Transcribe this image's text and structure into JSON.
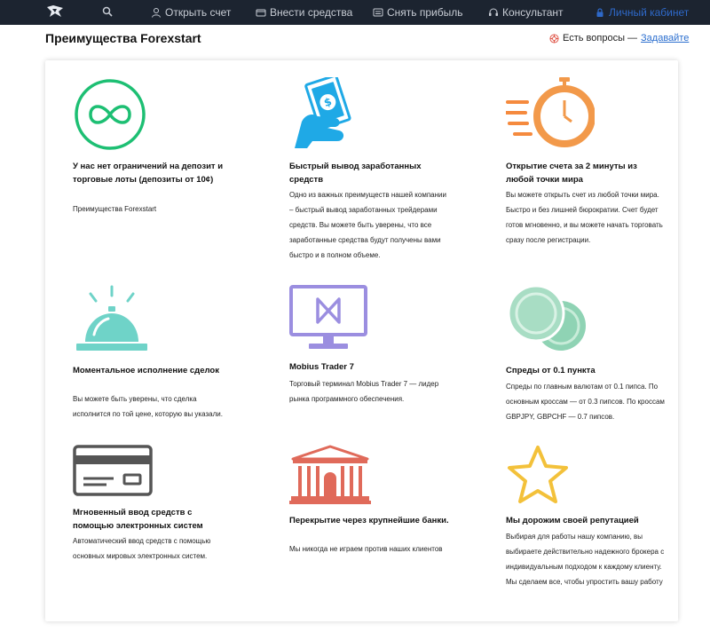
{
  "nav": {
    "items": [
      {
        "label": "Открыть счет",
        "icon": "user-icon"
      },
      {
        "label": "Внести средства",
        "icon": "wallet-icon"
      },
      {
        "label": "Снять прибыль",
        "icon": "cash-icon"
      },
      {
        "label": "Консультант",
        "icon": "headset-icon"
      },
      {
        "label": "Личный кабинет",
        "icon": "lock-icon"
      }
    ]
  },
  "header": {
    "title": "Преимущества Forexstart",
    "questions_text": "Есть вопросы —",
    "questions_link": "Задавайте"
  },
  "features": [
    {
      "title": "У нас нет ограничений на депозит и торговые лоты (депозиты от 10¢)",
      "desc": "Преимущества Forexstart",
      "icon": "infinity-icon",
      "color": "#1dbf73"
    },
    {
      "title": "Быстрый вывод заработанных средств",
      "desc": "Одно из важных преимуществ нашей компании – быстрый вывод заработанных трейдерами средств. Вы можете быть уверены, что все заработанные средства будут получены вами быстро и в полном объеме.",
      "icon": "hand-money-icon",
      "color": "#1fa9e6"
    },
    {
      "title": "Открытие счета за 2 минуты из любой точки мира",
      "desc": "Вы можете открыть счет из любой точки мира. Быстро и без лишней бюрократии. Счет будет готов мгновенно, и вы можете начать торговать сразу после регистрации.",
      "icon": "stopwatch-icon",
      "color": "#f2994a"
    },
    {
      "title": "Моментальное исполнение сделок",
      "desc": "Вы можете быть уверены, что сделка исполнится по той цене, которую вы указали.",
      "icon": "service-bell-icon",
      "color": "#6fd3c8"
    },
    {
      "title": "Mobius Trader 7",
      "desc": "Торговый терминал Mobius Trader 7 — лидер рынка программного обеспечения.",
      "icon": "monitor-icon",
      "color": "#9b8ee0"
    },
    {
      "title": "Спреды от 0.1 пункта",
      "desc": "Спреды по главным валютам от 0.1 пипса. По основным кроссам — от 0.3 пипсов. По кроссам GBPJPY, GBPCHF — 0.7 пипсов.",
      "icon": "coins-icon",
      "color": "#8fd3b4"
    },
    {
      "title": "Мгновенный ввод средств с помощью электронных систем",
      "desc": "Автоматический ввод средств с помощью основных мировых электронных систем.",
      "icon": "credit-card-icon",
      "color": "#555555"
    },
    {
      "title": "Перекрытие через крупнейшие банки.",
      "desc": "Мы никогда не играем против наших клиентов",
      "icon": "bank-icon",
      "color": "#e06a5a"
    },
    {
      "title": "Мы дорожим своей репутацией",
      "desc": "Выбирая для работы нашу компанию, вы выбираете действительно надежного брокера с индивидуальным подходом к каждому клиенту. Мы сделаем все, чтобы упростить вашу работу",
      "icon": "star-icon",
      "color": "#f3c13a"
    }
  ]
}
